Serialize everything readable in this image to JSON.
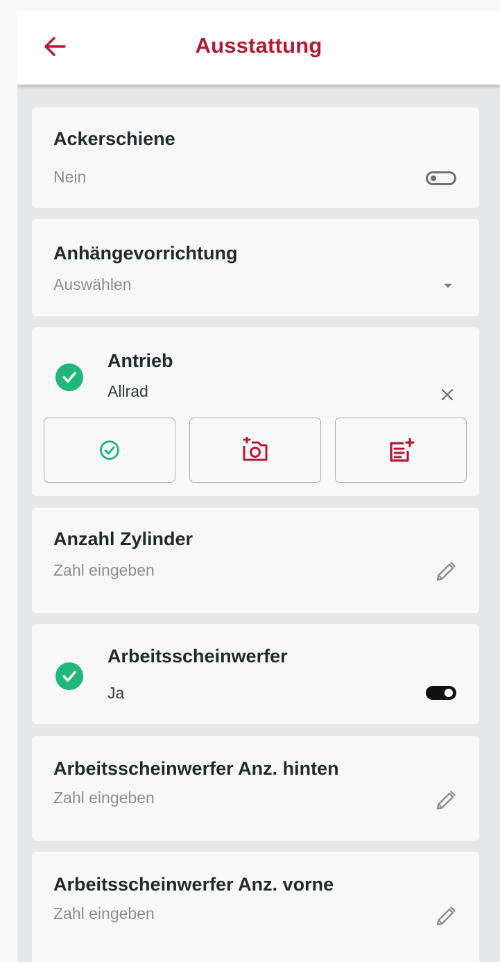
{
  "header": {
    "title": "Ausstattung",
    "back_icon": "arrow-left-icon",
    "accent_color": "#b51834"
  },
  "items": [
    {
      "title": "Ackerschiene",
      "value": "Nein",
      "control": "toggle",
      "toggle_on": false
    },
    {
      "title": "Anhängevorrichtung",
      "placeholder": "Auswählen",
      "control": "dropdown"
    },
    {
      "title": "Antrieb",
      "value": "Allrad",
      "control": "clear",
      "completed": true,
      "actions": [
        {
          "icon": "check-circle-icon"
        },
        {
          "icon": "add-photo-icon"
        },
        {
          "icon": "add-note-icon"
        }
      ]
    },
    {
      "title": "Anzahl Zylinder",
      "placeholder": "Zahl eingeben",
      "control": "edit"
    },
    {
      "title": "Arbeitsscheinwerfer",
      "value": "Ja",
      "control": "toggle",
      "toggle_on": true,
      "completed": true
    },
    {
      "title": "Arbeitsscheinwerfer Anz. hinten",
      "placeholder": "Zahl eingeben",
      "control": "edit"
    },
    {
      "title": "Arbeitsscheinwerfer Anz. vorne",
      "placeholder": "Zahl eingeben",
      "control": "edit"
    }
  ],
  "colors": {
    "success": "#1fb77a",
    "background": "#e6e7e8",
    "card": "#f8f8f9"
  }
}
